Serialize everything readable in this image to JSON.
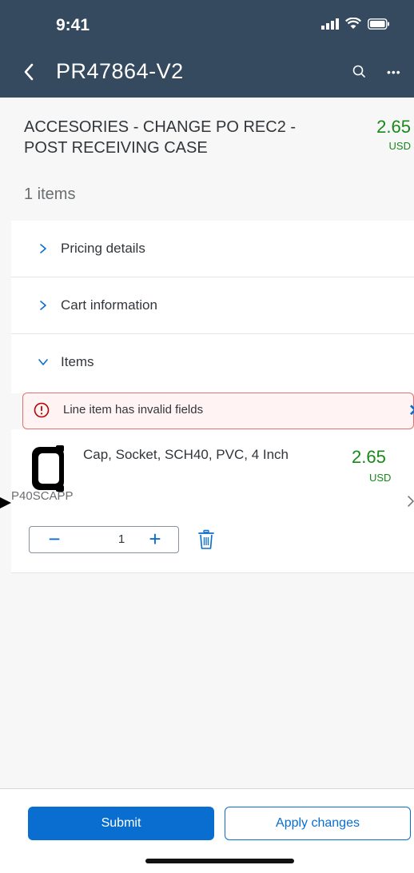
{
  "status_bar": {
    "time": "9:41"
  },
  "nav": {
    "title": "PR47864-V2",
    "more_label": "•••"
  },
  "cart": {
    "title": "ACCESORIES - CHANGE PO REC2 - POST RECEIVING CASE",
    "amount": "2.65",
    "currency": "USD",
    "items_count": "1 items"
  },
  "sections": [
    {
      "label": "Pricing details",
      "expanded": false
    },
    {
      "label": "Cart information",
      "expanded": false
    },
    {
      "label": "Items",
      "expanded": true
    }
  ],
  "message": {
    "text": "Line item has invalid fields",
    "close_label": "✕",
    "type": "error"
  },
  "item": {
    "name": "Cap, Socket, SCH40, PVC, 4 Inch",
    "price": "2.65",
    "currency": "USD",
    "sku": "P40SCAPP",
    "quantity": "1",
    "minus_label": "−",
    "plus_label": "+"
  },
  "footer": {
    "submit_label": "Submit",
    "apply_label": "Apply changes"
  },
  "colors": {
    "header_bg": "#354a5f",
    "accent": "#0a6ed1",
    "positive": "#188918",
    "error": "#e27272"
  },
  "icons": [
    "back-chevron-icon",
    "search-icon",
    "more-icon",
    "chevron-right-icon",
    "chevron-down-icon",
    "error-icon",
    "close-icon",
    "trash-icon",
    "signal-icon",
    "wifi-icon",
    "battery-icon"
  ]
}
